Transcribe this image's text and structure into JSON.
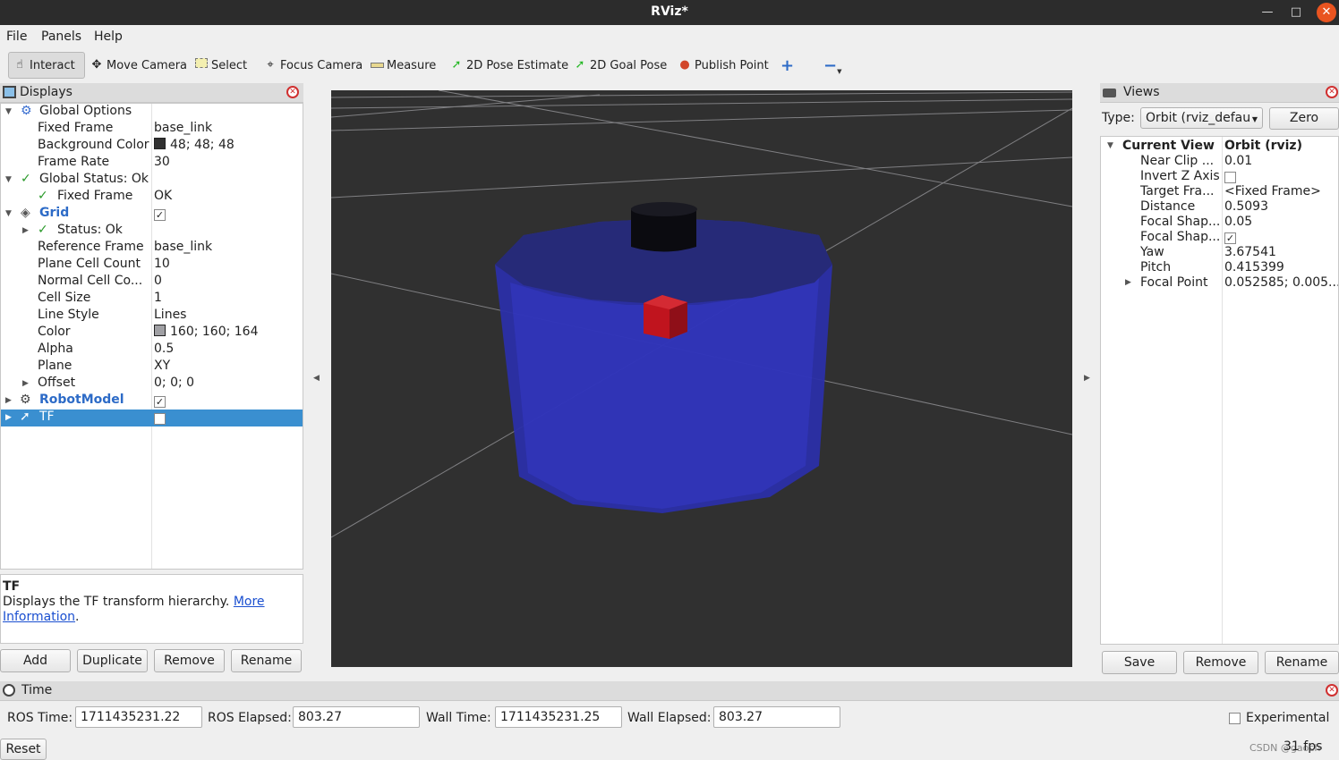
{
  "window": {
    "title": "RViz*"
  },
  "menu": {
    "file": "File",
    "panels": "Panels",
    "help": "Help"
  },
  "toolbar": {
    "interact": "Interact",
    "move_camera": "Move Camera",
    "select": "Select",
    "focus_camera": "Focus Camera",
    "measure": "Measure",
    "pose_estimate": "2D Pose Estimate",
    "goal_pose": "2D Goal Pose",
    "publish_point": "Publish Point"
  },
  "displays": {
    "title": "Displays",
    "rows": [
      {
        "label": "Global Options",
        "value": ""
      },
      {
        "label": "Fixed Frame",
        "value": "base_link"
      },
      {
        "label": "Background Color",
        "value": "48; 48; 48"
      },
      {
        "label": "Frame Rate",
        "value": "30"
      },
      {
        "label": "Global Status: Ok",
        "value": ""
      },
      {
        "label": "Fixed Frame",
        "value": "OK"
      },
      {
        "label": "Grid",
        "value": ""
      },
      {
        "label": "Status: Ok",
        "value": ""
      },
      {
        "label": "Reference Frame",
        "value": "base_link"
      },
      {
        "label": "Plane Cell Count",
        "value": "10"
      },
      {
        "label": "Normal Cell Co...",
        "value": "0"
      },
      {
        "label": "Cell Size",
        "value": "1"
      },
      {
        "label": "Line Style",
        "value": "Lines"
      },
      {
        "label": "Color",
        "value": "160; 160; 164"
      },
      {
        "label": "Alpha",
        "value": "0.5"
      },
      {
        "label": "Plane",
        "value": "XY"
      },
      {
        "label": "Offset",
        "value": "0; 0; 0"
      },
      {
        "label": "RobotModel",
        "value": ""
      },
      {
        "label": "TF",
        "value": ""
      }
    ],
    "background_color": "#303030",
    "grid_color": "#a0a0a4",
    "grid_enabled": true,
    "robotmodel_enabled": true,
    "tf_enabled": false
  },
  "description": {
    "title": "TF",
    "text": "Displays the TF transform hierarchy. ",
    "link1": "More",
    "link2": "Information",
    "end": "."
  },
  "display_buttons": {
    "add": "Add",
    "duplicate": "Duplicate",
    "remove": "Remove",
    "rename": "Rename"
  },
  "views": {
    "title": "Views",
    "type_label": "Type:",
    "type_value": "Orbit (rviz_defau",
    "zero": "Zero",
    "rows": [
      {
        "label": "Current View",
        "value": "Orbit (rviz)"
      },
      {
        "label": "Near Clip ...",
        "value": "0.01"
      },
      {
        "label": "Invert Z Axis",
        "value": ""
      },
      {
        "label": "Target Fra...",
        "value": "<Fixed Frame>"
      },
      {
        "label": "Distance",
        "value": "0.5093"
      },
      {
        "label": "Focal Shap...",
        "value": "0.05"
      },
      {
        "label": "Focal Shap...",
        "value": ""
      },
      {
        "label": "Yaw",
        "value": "3.67541"
      },
      {
        "label": "Pitch",
        "value": "0.415399"
      },
      {
        "label": "Focal Point",
        "value": "0.052585; 0.005..."
      }
    ],
    "invert_z": false,
    "focal_shape_fixed": true,
    "buttons": {
      "save": "Save",
      "remove": "Remove",
      "rename": "Rename"
    }
  },
  "time": {
    "title": "Time",
    "ros_time_label": "ROS Time:",
    "ros_time": "1711435231.22",
    "ros_elapsed_label": "ROS Elapsed:",
    "ros_elapsed": "803.27",
    "wall_time_label": "Wall Time:",
    "wall_time": "1711435231.25",
    "wall_elapsed_label": "Wall Elapsed:",
    "wall_elapsed": "803.27",
    "experimental": "Experimental",
    "reset": "Reset",
    "fps": "31 fps",
    "watermark": "CSDN @gaoch"
  },
  "colors": {
    "robot_body": "#2b2fa8",
    "robot_top": "#262a78",
    "lidar": "#0b0b10",
    "cube": "#c0141e",
    "selection": "#3a8fd0",
    "link_blue": "#2d6bc7"
  }
}
